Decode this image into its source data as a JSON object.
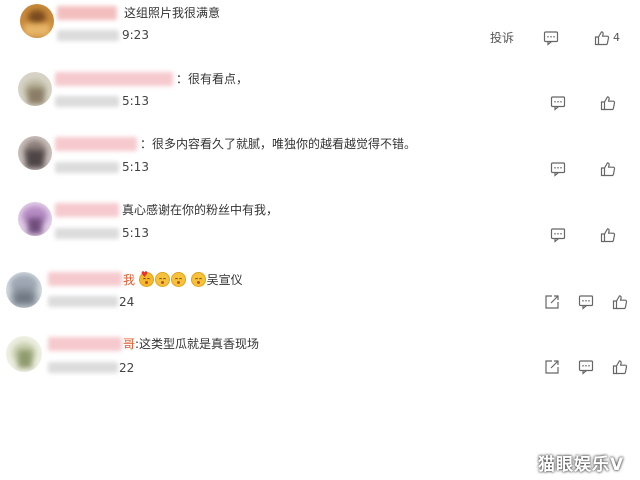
{
  "comments": [
    {
      "text": "这组照片我很满意",
      "time_suffix": "9:23",
      "report_label": "投诉",
      "like_count": "4",
      "colors": [
        "#c98b3a",
        "#7a4b1f",
        "#e8b66a"
      ]
    },
    {
      "text": "：很有看点，",
      "time_suffix": "5:13",
      "colors": [
        "#b9b59a",
        "#8a7c66",
        "#d7d3c6"
      ]
    },
    {
      "text": "：很多内容看久了就腻，唯独你的越看越觉得不错。",
      "time_suffix": "5:13",
      "colors": [
        "#8d7f7a",
        "#4e4547",
        "#c8bfbb"
      ]
    },
    {
      "text": "真心感谢在你的粉丝中有我，",
      "time_suffix": "5:13",
      "colors": [
        "#b48ac2",
        "#6f4d7c",
        "#e2cde8"
      ]
    },
    {
      "text_prefix": "我",
      "text_suffix": "吴宣仪",
      "time_suffix": "24",
      "colors": [
        "#9fa8b4",
        "#d7dde3",
        "#6e7783"
      ]
    },
    {
      "text_prefix": "哥",
      "text": ":这类型瓜就是真香现场",
      "time_suffix": "22",
      "colors": [
        "#c9d0b1",
        "#8f9a6d",
        "#eef0e2"
      ]
    }
  ],
  "watermark": "猫眼娱乐V",
  "icons": {
    "comment": "comment-icon",
    "like": "like-icon",
    "forward": "forward-icon"
  }
}
